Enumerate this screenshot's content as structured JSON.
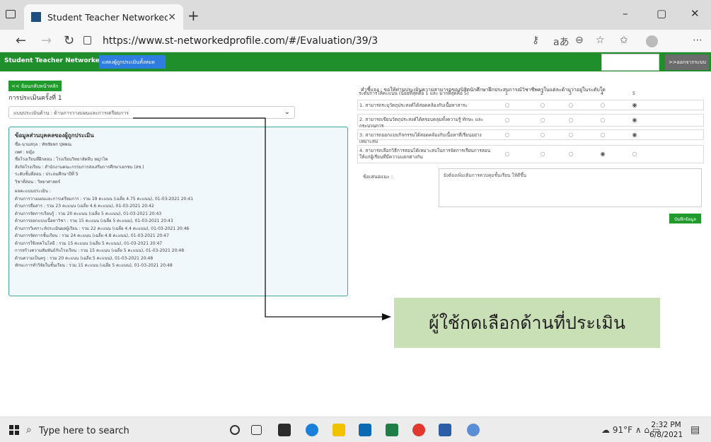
{
  "browser": {
    "tab_title": "Student Teacher Networked Prof",
    "tab_close": "×",
    "new_tab": "+",
    "url": "https://www.st-networkedprofile.com/#/Evaluation/39/3",
    "minimize": "–",
    "maximize": "▢",
    "close": "✕"
  },
  "site": {
    "brand": "Student Teacher Networked Profile",
    "show_all_button": "แสดงผู้ถูกประเมินทั้งหมด",
    "logout_button": ">>ออกจากระบบ"
  },
  "left": {
    "back_button": "<< ย้อนกลับหน้าหลัก",
    "eval_round": "การประเมินครั้งที่ 1",
    "aspect_select": "แบบประเมินด้าน : ด้านการวางแผนและการเตรียมการ",
    "info_heading": "ข้อมูลส่วนบุคคลของผู้ถูกประเมิน",
    "info_lines": [
      "ชื่อ-นามสกุล : ทัชชัยพร ปุพพณ",
      "เพศ : หญิง",
      "ชื่อโรงเรียนที่ฝึกสอน : โรงเรียนวิทยาสัตหีบ หญ่าไพ",
      "สังกัดโรงเรียน : สำนักงานคณะกรรมการส่งเสริมการศึกษาเอกชน (สช.)",
      "ระดับชั้นที่สอน : ประถมศึกษาปีที่ 5",
      "วิชาที่สอน : วิทยาศาสตร์",
      "ผลคะแนนประเมิน :",
      "ด้านการวางแผนและการเตรียมการ : รวม 19 คะแนน (เฉลี่ย 4.75 คะแนน), 01-03-2021 20:41",
      "ด้านการสื่อสาร : รวม 23 คะแนน (เฉลี่ย 4.6 คะแนน), 01-03-2021 20:42",
      "ด้านการจัดการเรียนรู้ : รวม 20 คะแนน (เฉลี่ย 5 คะแนน), 01-03-2021 20:43",
      "ด้านการออกแบบเนื้อหาวิชา : รวม 15 คะแนน (เฉลี่ย 5 คะแนน), 01-03-2021 20:43",
      "ด้านการวิเคราะห์ประเมินผลผู้เรียน : รวม 22 คะแนน (เฉลี่ย 4.4 คะแนน), 01-03-2021 20:46",
      "ด้านการจัดการชั้นเรียน : รวม 24 คะแนน (เฉลี่ย 4.8 คะแนน), 01-03-2021 20:47",
      "ด้านการใช้เทคโนโลยี : รวม 15 คะแนน (เฉลี่ย 5 คะแนน), 01-03-2021 20:47",
      "การสร้างความสัมพันธ์กับโรงเรียน : รวม 15 คะแนน (เฉลี่ย 5 คะแนน), 01-03-2021 20:48",
      "ด้านความเป็นครู : รวม 20 คะแนน (เฉลี่ย 5 คะแนน), 01-03-2021 20:48",
      "ทักษะการทำวิจัยในชั้นเรียน : รวม 15 คะแนน (เฉลี่ย 5 คะแนน), 01-03-2021 20:48"
    ]
  },
  "right": {
    "instructions": "คำชี้แจง : ขอให้ท่านประเมินความสามารถของนิสิตนักศึกษาฝึกประสบการณ์วิชาชีพครูในแต่ละด้านว่าอยู่ในระดับใด",
    "scale_header": "ระดับการให้คะแนน (น้อยที่สุดคือ 1 และ มากที่สุดคือ 5)",
    "scale": [
      "1",
      "2",
      "3",
      "4",
      "5"
    ],
    "questions": [
      {
        "text": "1. สามารถระบุวัตถุประสงค์ได้สอดคล้องกับเนื้อหาสาระ",
        "selected": 5
      },
      {
        "text": "2. สามารถเขียนวัตถุประสงค์ได้ครอบคลุมทั้งความรู้ ทักษะ และกระบวนการ",
        "selected": 5
      },
      {
        "text": "3. สามารถออกแบบกิจกรรมได้สอดคล้องกับเนื้อหาที่เรียนอย่างเหมาะสม",
        "selected": 5
      },
      {
        "text": "4. สามารถเลือกวิธีการสอนได้เหมาะสมในการจัดการเรียนการสอนให้แก่ผู้เรียนที่มีความแตกต่างกัน",
        "selected": 4
      }
    ],
    "suggest_label": "ข้อเสนอแนะ :",
    "suggest_text": "ยังต้องเพิ่มเติมการควบคุมชั้นเรียน ให้ดีขึ้น",
    "save_button": "บันทึกข้อมูล"
  },
  "annotation": "ผู้ใช้กดเลือกด้านที่ประเมิน",
  "taskbar": {
    "search_placeholder": "Type here to search",
    "weather": "91°F",
    "time": "2:32 PM",
    "date": "6/8/2021"
  },
  "colors": {
    "site_header": "#1f8f2c",
    "primary_button": "#2f7de0",
    "info_border": "#3fa9a9",
    "annotation_bg": "#c9e0b7"
  }
}
